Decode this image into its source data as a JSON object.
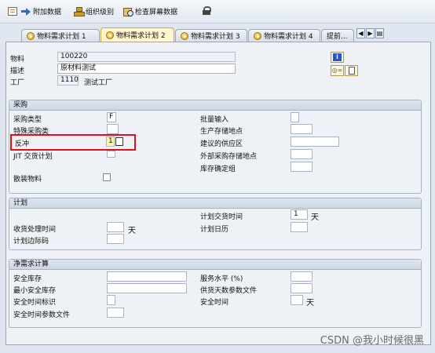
{
  "toolbar": {
    "append_data": "附加数据",
    "org_levels": "组织级别",
    "check_screen_data": "检查屏幕数据"
  },
  "tabs": [
    {
      "label": "物料需求计划 1"
    },
    {
      "label": "物料需求计划 2"
    },
    {
      "label": "物料需求计划 3"
    },
    {
      "label": "物料需求计划 4"
    },
    {
      "label": "提前..."
    }
  ],
  "header": {
    "material_label": "物料",
    "material_value": "100220",
    "desc_label": "描述",
    "desc_value": "原材料测试",
    "plant_label": "工厂",
    "plant_value": "1110",
    "plant_name": "测试工厂"
  },
  "procurement": {
    "title": "采购",
    "procurement_type_label": "采购类型",
    "procurement_type_value": "F",
    "special_proc_label": "特殊采购类",
    "backflush_label": "反冲",
    "backflush_value": "1",
    "jit_label": "JIT 交货计划",
    "bulk_label": "散装物料",
    "batch_entry_label": "批量输入",
    "prod_stor_label": "生产存储地点",
    "supply_area_label": "建议的供应区",
    "ext_stor_label": "外部采购存储地点",
    "stock_group_label": "库存确定组"
  },
  "scheduling": {
    "title": "计划",
    "gr_time_label": "收货处理时间",
    "gr_time_unit": "天",
    "margin_key_label": "计划边际码",
    "delivery_time_label": "计划交货时间",
    "delivery_time_value": "1",
    "delivery_time_unit": "天",
    "calendar_label": "计划日历"
  },
  "net_requirements": {
    "title": "净需求计算",
    "safety_stock_label": "安全库存",
    "min_safety_stock_label": "最小安全库存",
    "safety_time_ind_label": "安全时间标识",
    "safety_time_profile_label": "安全时间参数文件",
    "service_level_label": "服务水平 (%)",
    "coverage_profile_label": "供货天数参数文件",
    "safety_time_label": "安全时间",
    "safety_time_unit": "天"
  },
  "watermark": "CSDN @我小时候很黑"
}
